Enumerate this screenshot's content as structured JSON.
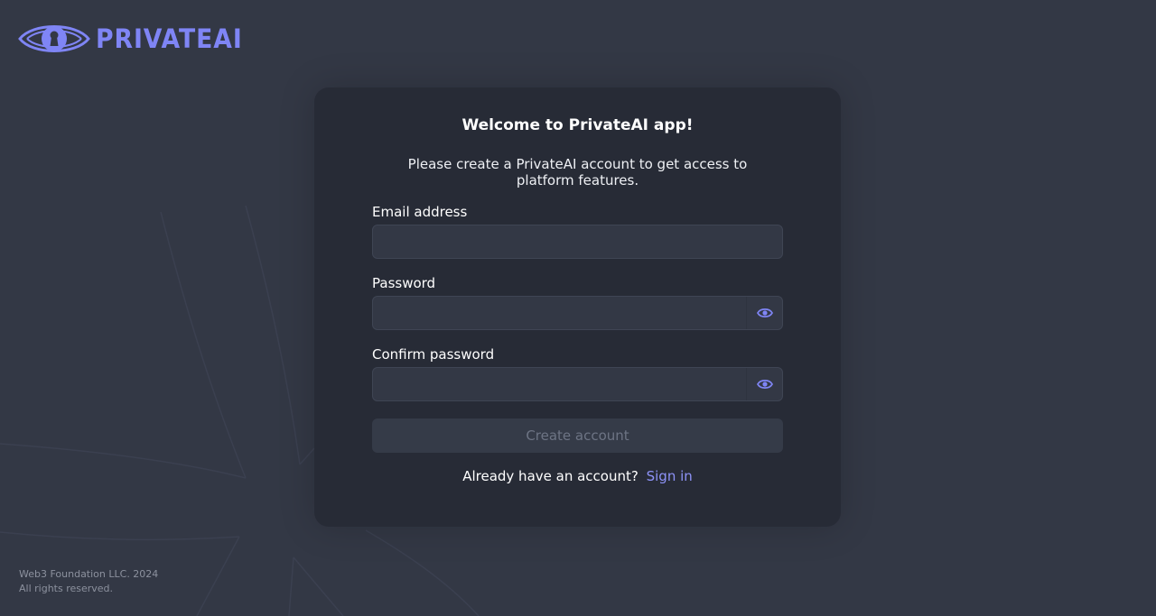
{
  "brand": {
    "name": "PRIVATEAI",
    "icon": "eye-keyhole-logo",
    "color": "#7f85f5"
  },
  "card": {
    "title": "Welcome to PrivateAI app!",
    "subtitle": "Please create a PrivateAI account to get access to platform features."
  },
  "form": {
    "email": {
      "label": "Email address",
      "value": "",
      "placeholder": ""
    },
    "password": {
      "label": "Password",
      "value": "",
      "placeholder": "",
      "toggle_icon": "eye-icon"
    },
    "confirm": {
      "label": "Confirm password",
      "value": "",
      "placeholder": "",
      "toggle_icon": "eye-icon"
    },
    "submit_label": "Create account",
    "signin_prompt": "Already have an account?",
    "signin_link": "Sign in"
  },
  "footer": {
    "line1": "Web3 Foundation LLC. 2024",
    "line2": "All rights reserved."
  },
  "colors": {
    "background": "#333845",
    "card": "#272b36",
    "accent": "#7f85f5",
    "button_disabled": "#353b48"
  }
}
